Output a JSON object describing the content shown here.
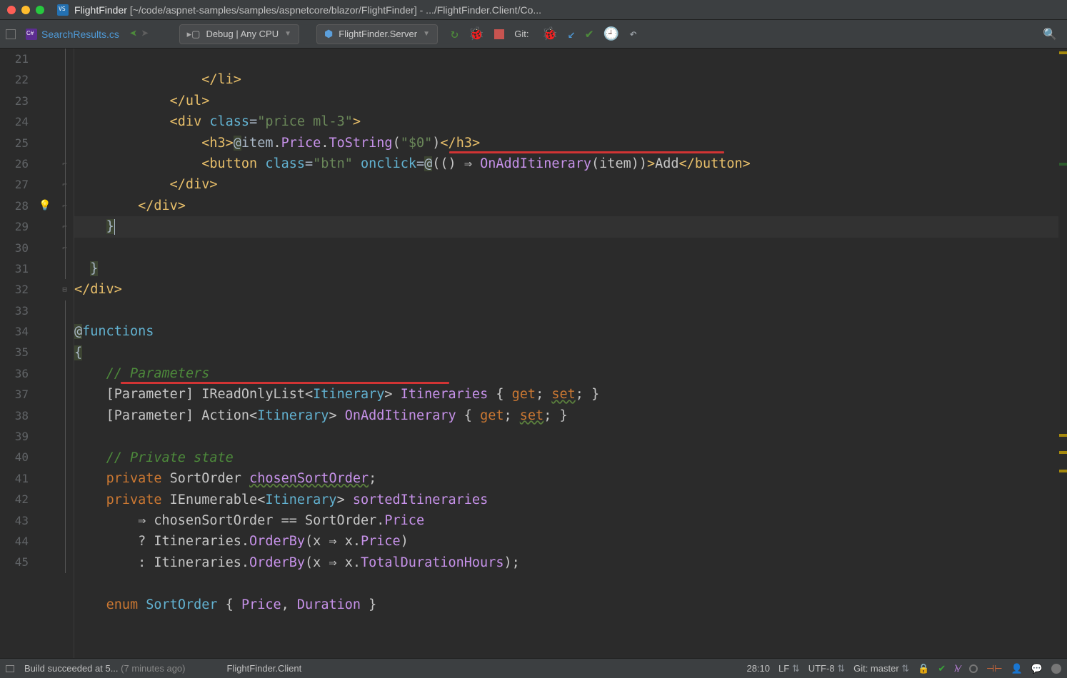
{
  "window": {
    "title_bold": "FlightFinder",
    "title_path": "[~/code/aspnet-samples/samples/aspnetcore/blazor/FlightFinder] - .../FlightFinder.Client/Co..."
  },
  "tab": {
    "filename": "SearchResults.cs"
  },
  "run_config": {
    "label": "Debug | Any CPU",
    "server": "FlightFinder.Server"
  },
  "git_label": "Git:",
  "gutter": {
    "start": 21,
    "end": 45
  },
  "code": {
    "l21": "                </li>",
    "l22": "            </ul>",
    "l23": "            <div class=\"price ml-3\">",
    "l24": "                <h3>@item.Price.ToString(\"$0\")</h3>",
    "l25": "                <button class=\"btn\" onclick=@(() ⇒ OnAddItinerary(item))>Add</button>",
    "l26": "            </div>",
    "l27": "        </div>",
    "l28": "    }",
    "l29": "  }",
    "l30": "</div>",
    "l32": "@functions",
    "l33": "{",
    "l34_c": "    // Parameters",
    "l35": "    [Parameter] IReadOnlyList<Itinerary> Itineraries { get; set; }",
    "l36": "    [Parameter] Action<Itinerary> OnAddItinerary { get; set; }",
    "l38_c": "    // Private state",
    "l39_a": "    private",
    "l39_b": "SortOrder",
    "l39_c": "chosenSortOrder",
    "l40_a": "    private",
    "l40_b": "IEnumerable<Itinerary>",
    "l40_c": "sortedItineraries",
    "l41": "        ⇒ chosenSortOrder == SortOrder.Price",
    "l42": "        ? Itineraries.OrderBy(x ⇒ x.Price)",
    "l43": "        : Itineraries.OrderBy(x ⇒ x.TotalDurationHours);",
    "l45_a": "    enum",
    "l45_b": "SortOrder",
    "l45_c": "{ Price, Duration }"
  },
  "status": {
    "build_msg": "Build succeeded at 5...",
    "build_age": "(7 minutes ago)",
    "project": "FlightFinder.Client",
    "caret": "28:10",
    "line_ending": "LF",
    "encoding": "UTF-8",
    "git_branch": "Git: master"
  }
}
